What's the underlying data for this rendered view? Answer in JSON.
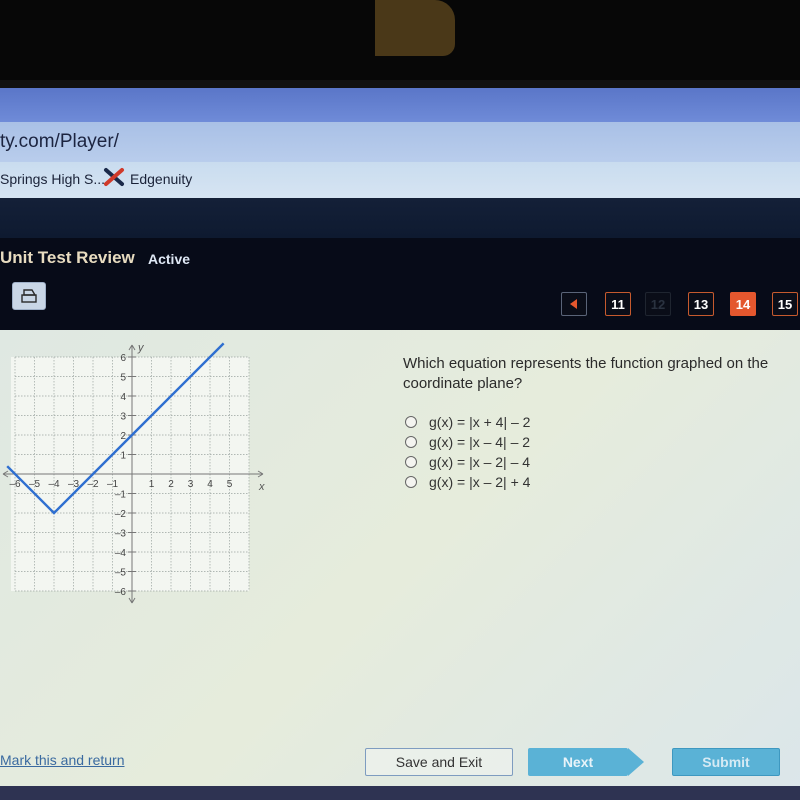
{
  "browser": {
    "url": "ty.com/Player/",
    "bookmarks": [
      {
        "label": "Springs High S..."
      },
      {
        "label": "Edgenuity",
        "icon": "edgenuity-x-icon"
      }
    ]
  },
  "header": {
    "title": "Unit Test Review",
    "status": "Active",
    "print_icon": "printer-icon"
  },
  "question_nav": {
    "prev_icon": "triangle-left-icon",
    "items": [
      {
        "label": "11",
        "state": "normal"
      },
      {
        "label": "12",
        "state": "disabled"
      },
      {
        "label": "13",
        "state": "normal"
      },
      {
        "label": "14",
        "state": "current"
      },
      {
        "label": "15",
        "state": "normal"
      }
    ]
  },
  "question": {
    "text": "Which equation represents the function graphed on the coordinate plane?",
    "options": [
      {
        "label": "g(x) = |x + 4| – 2"
      },
      {
        "label": "g(x) = |x – 4| – 2"
      },
      {
        "label": "g(x) = |x – 2| – 4"
      },
      {
        "label": "g(x) = |x – 2| + 4"
      }
    ]
  },
  "graph": {
    "type": "line",
    "xlabel": "x",
    "ylabel": "y",
    "xlim": [
      -6,
      6
    ],
    "ylim": [
      -6,
      6
    ],
    "x_ticks": [
      "-6",
      "-5",
      "-4",
      "-3",
      "-2",
      "-1",
      "1",
      "2",
      "3",
      "4",
      "5"
    ],
    "y_ticks": [
      "6",
      "5",
      "4",
      "3",
      "2",
      "1",
      "-1",
      "-2",
      "-3",
      "-4",
      "-5",
      "-6"
    ],
    "grid": true,
    "line_color": "#2f6fd0",
    "vertex": [
      -4,
      -2
    ],
    "points": [
      [
        -6.4,
        0.4
      ],
      [
        -4,
        -2
      ],
      [
        4.7,
        6.7
      ]
    ]
  },
  "footer": {
    "mark_link": "Mark this and return",
    "save_label": "Save and Exit",
    "next_label": "Next",
    "submit_label": "Submit"
  }
}
